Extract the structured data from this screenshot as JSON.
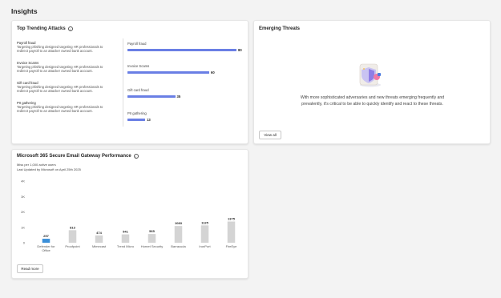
{
  "page": {
    "title": "Insights"
  },
  "top_trending": {
    "title": "Top Trending Attacks",
    "attacks": [
      {
        "name": "Payroll fraud",
        "desc_line1": "Targeting phishing designed targeting HR professionals to",
        "desc_line2": "redirect payroll to an attacker owned bank account."
      },
      {
        "name": "Invoice Scams",
        "desc_line1": "Targeting phishing designed targeting HR professionals to",
        "desc_line2": "redirect payroll to an attacker owned bank account."
      },
      {
        "name": "Gift card fraud",
        "desc_line1": "Targeting phishing designed targeting HR professionals to",
        "desc_line2": "redirect payroll to an attacker owned bank account."
      },
      {
        "name": "PII gathering",
        "desc_line1": "Targeting phishing designed targeting HR professionals to",
        "desc_line2": "redirect payroll to an attacker owned bank account."
      }
    ],
    "bars": [
      {
        "label": "Payroll fraud",
        "value": 80
      },
      {
        "label": "Invoice Scams",
        "value": 60
      },
      {
        "label": "Gift card fraud",
        "value": 35
      },
      {
        "label": "PII gathering",
        "value": 13
      }
    ],
    "bar_color": "#6a7fe5"
  },
  "emerging": {
    "title": "Emerging Threats",
    "text_line1": "With more sophisticated adversaries and new threats emerging frequently and",
    "text_line2": "prevalently, it's critical to be able to quickly identify and react to these threats.",
    "button": "View all",
    "illustration_icon": "threat-shield-icon"
  },
  "gateway": {
    "title": "Microsoft 365 Secure Email Gateway Performance",
    "subtitle1": "Miss per 1,000 active users",
    "subtitle2": "Last Updated by Microsoft on April 25th 2025",
    "button": "Read more",
    "highlight_color": "#3b8fd9",
    "bar_color": "#d4d4d4"
  },
  "chart_data": {
    "type": "bar",
    "categories": [
      "Defender for Office",
      "Proofpoint",
      "Mimecast",
      "Trend Micro",
      "Hornet Security",
      "Barracuda",
      "IronPort",
      "FireEye"
    ],
    "values": [
      257,
      813,
      474,
      541,
      565,
      1083,
      1125,
      1375
    ],
    "labels": [
      "257",
      "813",
      "474",
      "541",
      "565",
      "1083",
      "1125",
      "1375"
    ],
    "y_ticks": [
      "0",
      "1K",
      "2K",
      "3K",
      "4K"
    ],
    "ylim": [
      0,
      4
    ]
  }
}
